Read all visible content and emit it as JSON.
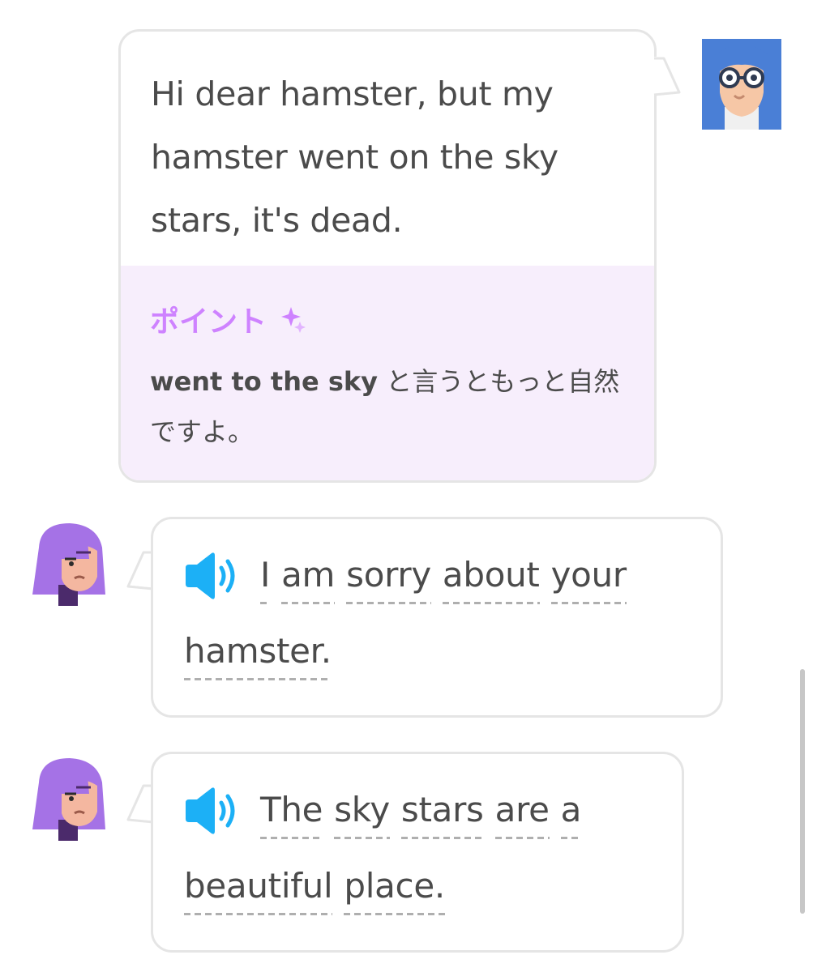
{
  "user_message": {
    "text": "Hi dear hamster, but my hamster went on the sky stars, it's dead.",
    "tip_title": "ポイント",
    "tip_phrase": "went to the sky",
    "tip_text": " と言うともっと自然ですよ。"
  },
  "bot_messages": [
    {
      "line1": [
        "I",
        "am",
        "sorry",
        "about",
        "your"
      ],
      "line2": [
        "hamster."
      ]
    },
    {
      "line1": [
        "The",
        "sky",
        "stars",
        "are",
        "a"
      ],
      "line2": [
        "beautiful",
        "place."
      ]
    }
  ],
  "colors": {
    "bubble_border": "#e5e5e5",
    "tip_background": "#f7eefc",
    "tip_accent": "#ce82ff",
    "speaker": "#1cb0f6",
    "text": "#4b4b4b"
  },
  "icons": {
    "user_avatar": "user-avatar-glasses",
    "bot_avatar": "lily-avatar",
    "speaker": "speaker-icon",
    "sparkle": "sparkle-icon"
  }
}
